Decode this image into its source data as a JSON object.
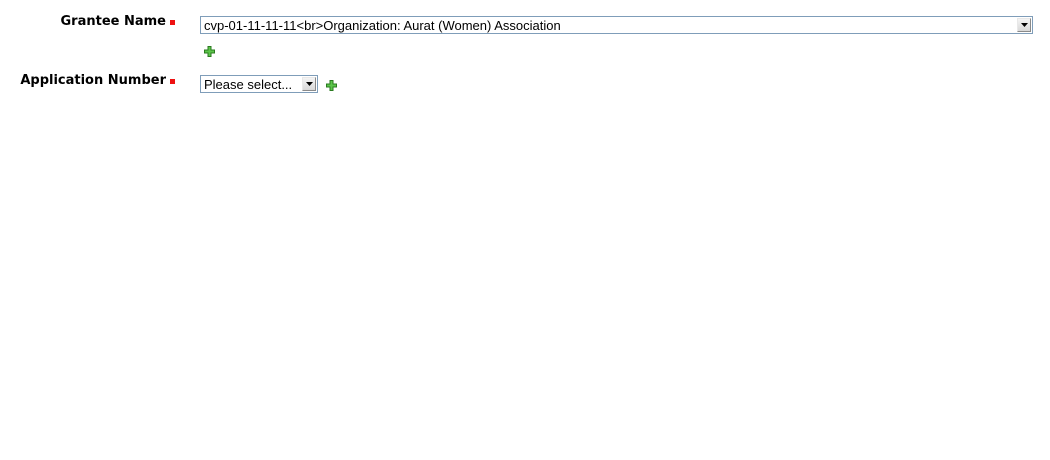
{
  "form": {
    "grantee": {
      "label": "Grantee Name",
      "selected_value": "cvp-01-11-11-11<br>Organization: Aurat (Women) Association",
      "add_icon": "plus-icon"
    },
    "application": {
      "label": "Application Number",
      "selected_value": "Please select...",
      "add_icon": "plus-icon"
    }
  },
  "colors": {
    "required_marker": "#ee1111",
    "add_icon": "#33a02c",
    "select_border": "#7f9db9"
  }
}
